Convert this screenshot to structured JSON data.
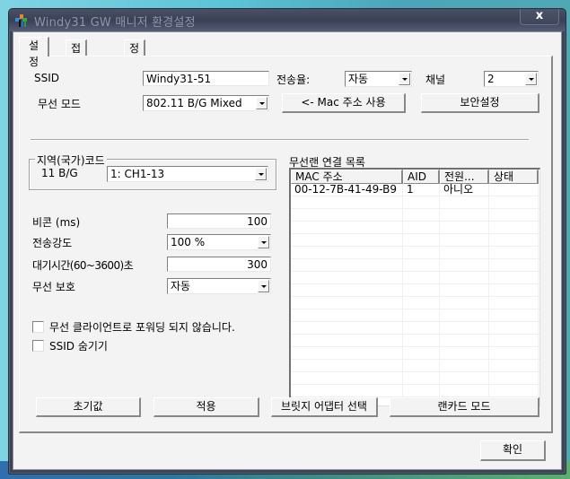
{
  "window": {
    "title": "Windy31 GW 매니저 환경설정",
    "close_label": "x"
  },
  "tabs": [
    {
      "label": "설정",
      "active": true
    },
    {
      "label": "접근 제어",
      "active": false
    },
    {
      "label": "정보",
      "active": false
    }
  ],
  "settings": {
    "ssid_label": "SSID",
    "ssid_value": "Windy31-51",
    "rate_label": "전송율:",
    "rate_value": "자동",
    "channel_label": "채널",
    "channel_value": "2",
    "mode_label": "무선 모드",
    "mode_value": "802.11 B/G Mixed",
    "use_mac_button": "<- Mac 주소 사용",
    "security_button": "보안설정"
  },
  "region": {
    "group_title": "지역(국가)코드",
    "band_label": "11 B/G",
    "code_value": "1: CH1-13"
  },
  "advanced": {
    "beacon_label": "비콘 (ms)",
    "beacon_value": "100",
    "tx_power_label": "전송강도",
    "tx_power_value": "100 %",
    "idle_label": "대기시간(60~3600)초",
    "idle_value": "300",
    "protection_label": "무선 보호",
    "protection_value": "자동"
  },
  "options": {
    "no_forward_label": "무선 클라이언트로 포워딩 되지 않습니다.",
    "no_forward_checked": false,
    "hide_ssid_label": "SSID 숨기기",
    "hide_ssid_checked": false
  },
  "client_list": {
    "title": "무선랜 연결 목록",
    "columns": [
      "MAC 주소",
      "AID",
      "전원...",
      "상태"
    ],
    "rows": [
      [
        "00-12-7B-41-49-B9",
        "1",
        "아니오",
        ""
      ]
    ]
  },
  "actions": {
    "defaults": "초기값",
    "apply": "적용",
    "bridge_select": "브릿지 어댑터 선택",
    "lancard_mode": "랜카드 모드"
  },
  "ok_button": "확인"
}
